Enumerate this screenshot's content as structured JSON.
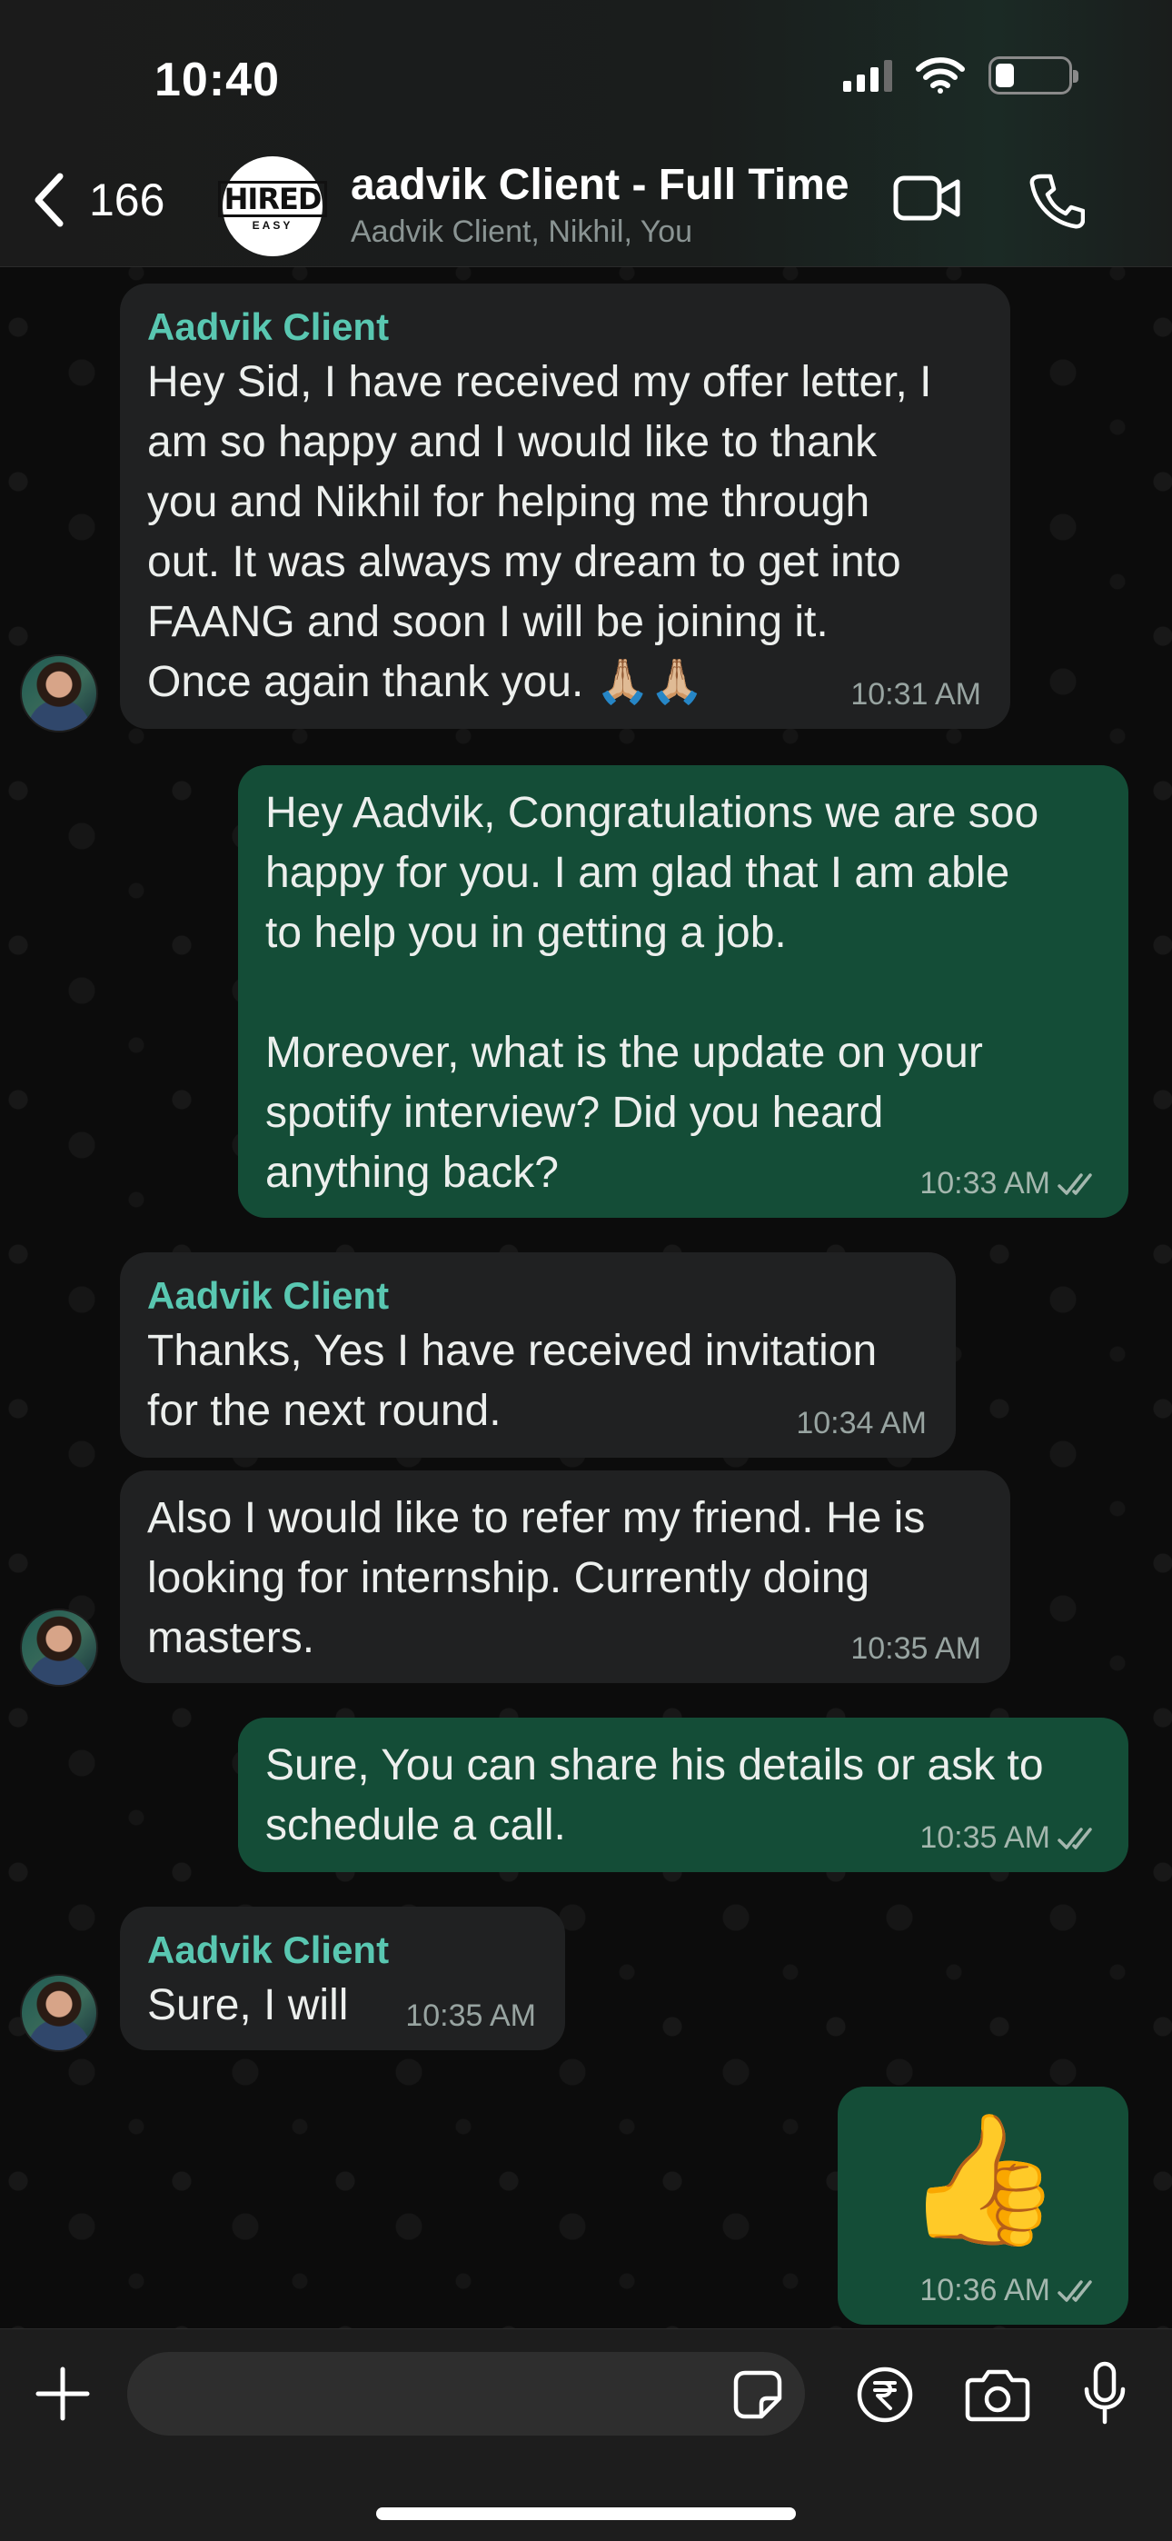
{
  "status_bar": {
    "time": "10:40"
  },
  "header": {
    "back_count": "166",
    "group_logo_text": "HIRED",
    "group_logo_sub": "EASY",
    "title": "aadvik Client - Full Time",
    "subtitle": "Aadvik Client, Nikhil, You"
  },
  "messages": [
    {
      "type": "incoming",
      "sender": "Aadvik Client",
      "text": "Hey Sid, I have received my offer letter, I\nam so happy and I would like to thank\nyou and Nikhil for helping me through\nout. It was always my dream to get into\nFAANG and soon I will be joining it.\nOnce again thank you. 🙏🏼🙏🏼",
      "time": "10:31 AM"
    },
    {
      "type": "outgoing",
      "text": "Hey Aadvik, Congratulations we are soo\nhappy for you. I am glad that I am able\nto help you in getting a job.\n\nMoreover, what is the update on your\nspotify interview? Did you heard\nanything back?",
      "time": "10:33 AM"
    },
    {
      "type": "incoming",
      "sender": "Aadvik Client",
      "text": "Thanks, Yes I have received invitation\nfor the next round.",
      "time": "10:34 AM"
    },
    {
      "type": "incoming",
      "text": "Also I would like to refer my friend. He is\nlooking for internship. Currently doing\nmasters.",
      "time": "10:35 AM"
    },
    {
      "type": "outgoing",
      "text": "Sure, You can share his details or ask to\nschedule a call.",
      "time": "10:35 AM"
    },
    {
      "type": "incoming",
      "sender": "Aadvik Client",
      "text": "Sure, I will",
      "time": "10:35 AM"
    },
    {
      "type": "outgoing",
      "text": "👍",
      "time": "10:36 AM"
    }
  ],
  "input": {
    "value": "",
    "placeholder": ""
  },
  "icons": {
    "back": "chevron-left-icon",
    "video": "video-call-icon",
    "phone": "phone-icon",
    "plus": "plus-icon",
    "sticker": "sticker-icon",
    "rupee": "rupee-payment-icon",
    "camera": "camera-icon",
    "mic": "microphone-icon"
  },
  "colors": {
    "incoming_bubble": "#202122",
    "outgoing_bubble": "#144d37",
    "sender_name": "#59c7b1"
  }
}
